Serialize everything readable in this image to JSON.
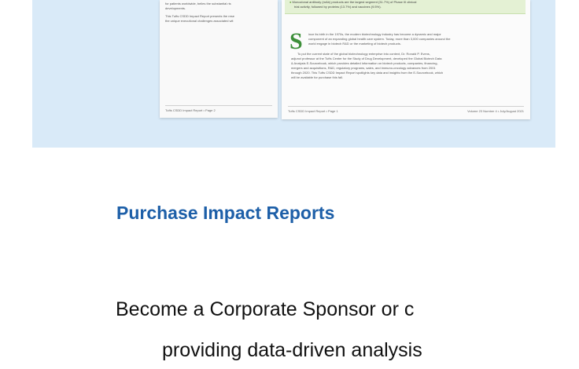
{
  "left_page": {
    "lines": [
      "for patients worldwide, belies the substantial ris",
      "developments.",
      "This Tufts CSDD Impact Report presents the rese",
      "the unique executional challenges associated wit"
    ],
    "footer": "Tufts CSDD Impact Report • Page 2"
  },
  "right_page": {
    "highlight_lines": [
      "Monoclonal antibody (mAb) products are the largest segment (31.7%) of Phase III clinical",
      "trial activity, followed by proteins (13.7%) and vaccines (9.5%)."
    ],
    "drop_cap": "S",
    "intro_lines": [
      "ince its birth in the 1970s, the modern biotechnology industry has become a dynamic and major",
      "component of an expanding global health care system. Today, more than 3,000 companies around the",
      "world engage in biotech R&D or the marketing of biotech products."
    ],
    "body_lines": [
      "To put the current state of the global biotechnology enterprise into context, Dr. Ronald P. Evens,",
      "adjunct professor at the Tufts Center for the Study of Drug Development, developed the Global Biotech Data",
      "& Analysis E-Sourcebook, which provides detailed information on biotech products, companies, financing,",
      "mergers and acquisitions, R&D, regulatory programs, sales, and immuno-oncology advances from 2001",
      "through 2020. This Tufts CSDD Impact Report spotlights key data and insights from the E-Sourcebook, which",
      "will be available for purchase this fall."
    ],
    "footer_left": "Tufts CSDD Impact Report • Page 1",
    "footer_right": "Volume 23 Number 4 • July/August 2021"
  },
  "section": {
    "title": "Purchase Impact Reports"
  },
  "body": {
    "line1": "Become a Corporate Sponsor or c",
    "line2": "providing data-driven analysis"
  },
  "colors": {
    "hero_background": "#d9eaf8",
    "title": "#1d5fa8",
    "highlight_box": "#e4f1d4",
    "drop_cap": "#3d8f3a"
  }
}
